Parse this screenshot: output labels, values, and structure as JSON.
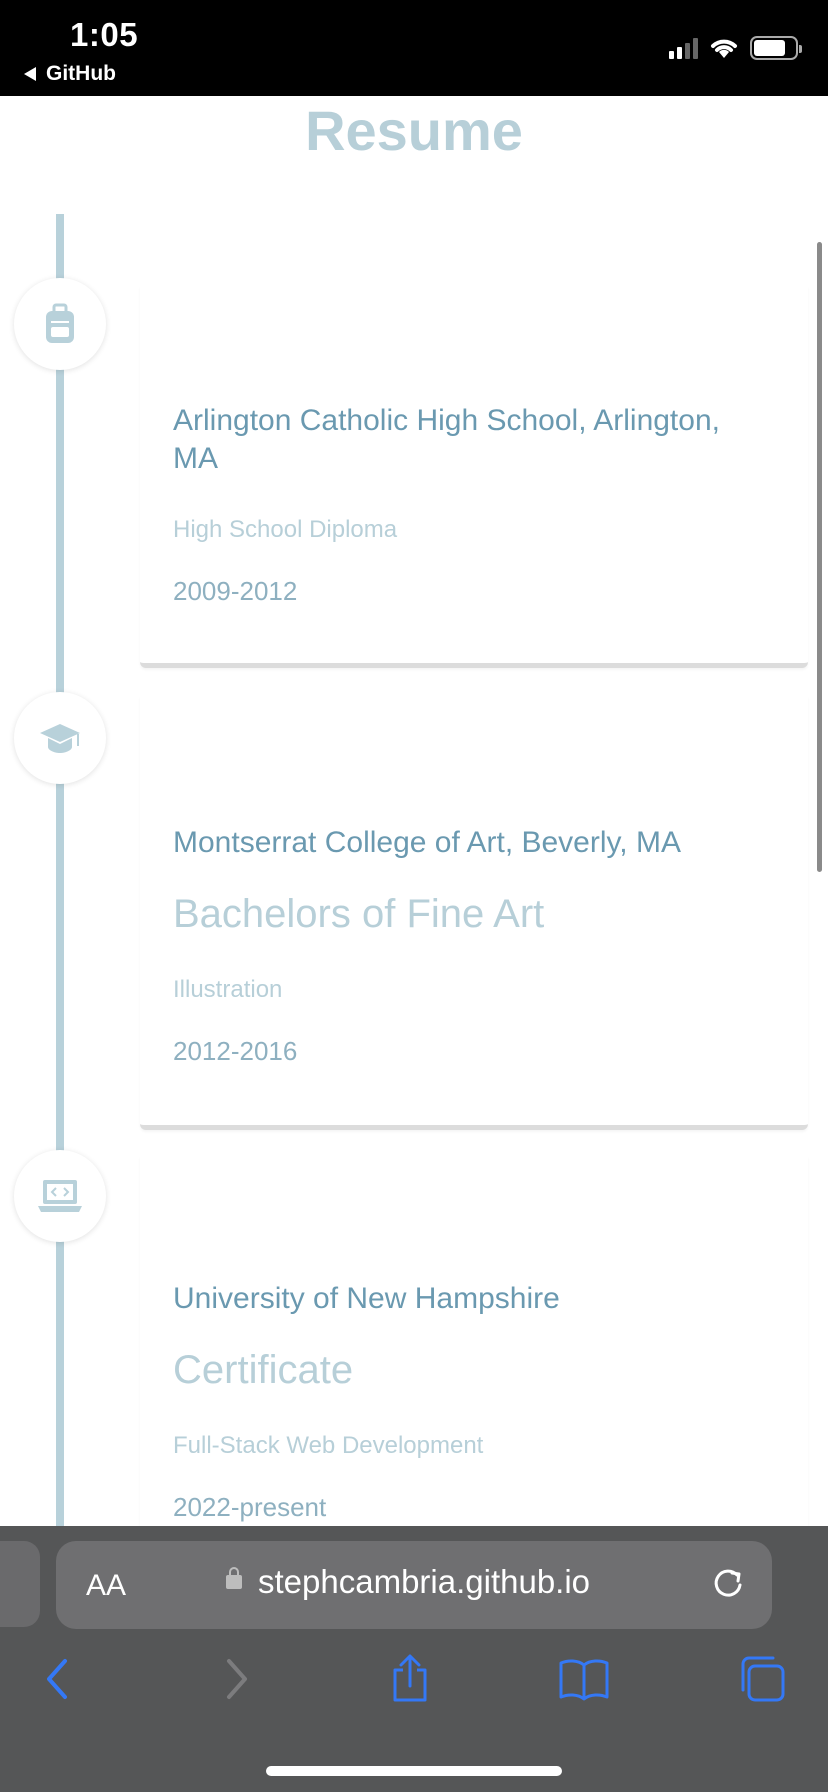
{
  "status_bar": {
    "time": "1:05",
    "back_label": "GitHub",
    "icons": [
      "signal-icon",
      "wifi-icon",
      "battery-icon"
    ]
  },
  "page": {
    "title": "Resume",
    "entries": [
      {
        "icon": "backpack-icon",
        "school": "Arlington Catholic High School, Arlington, MA",
        "degree": "",
        "field": "High School Diploma",
        "years": "2009-2012"
      },
      {
        "icon": "graduation-cap-icon",
        "school": "Montserrat College of Art, Beverly, MA",
        "degree": "Bachelors of Fine Art",
        "field": "Illustration",
        "years": "2012-2016"
      },
      {
        "icon": "laptop-code-icon",
        "school": "University of New Hampshire",
        "degree": "Certificate",
        "field": "Full-Stack Web Development",
        "years": "2022-present"
      }
    ]
  },
  "browser": {
    "text_size_label": "AA",
    "url": "stephcambria.github.io",
    "toolbar": [
      "back-icon",
      "forward-icon",
      "share-icon",
      "bookmarks-icon",
      "tabs-icon"
    ]
  },
  "colors": {
    "accent": "#6a99b0",
    "muted": "#b7cfd8",
    "timeline": "#b8d1da",
    "browser_chrome": "#555657",
    "ios_blue": "#3478f6"
  }
}
